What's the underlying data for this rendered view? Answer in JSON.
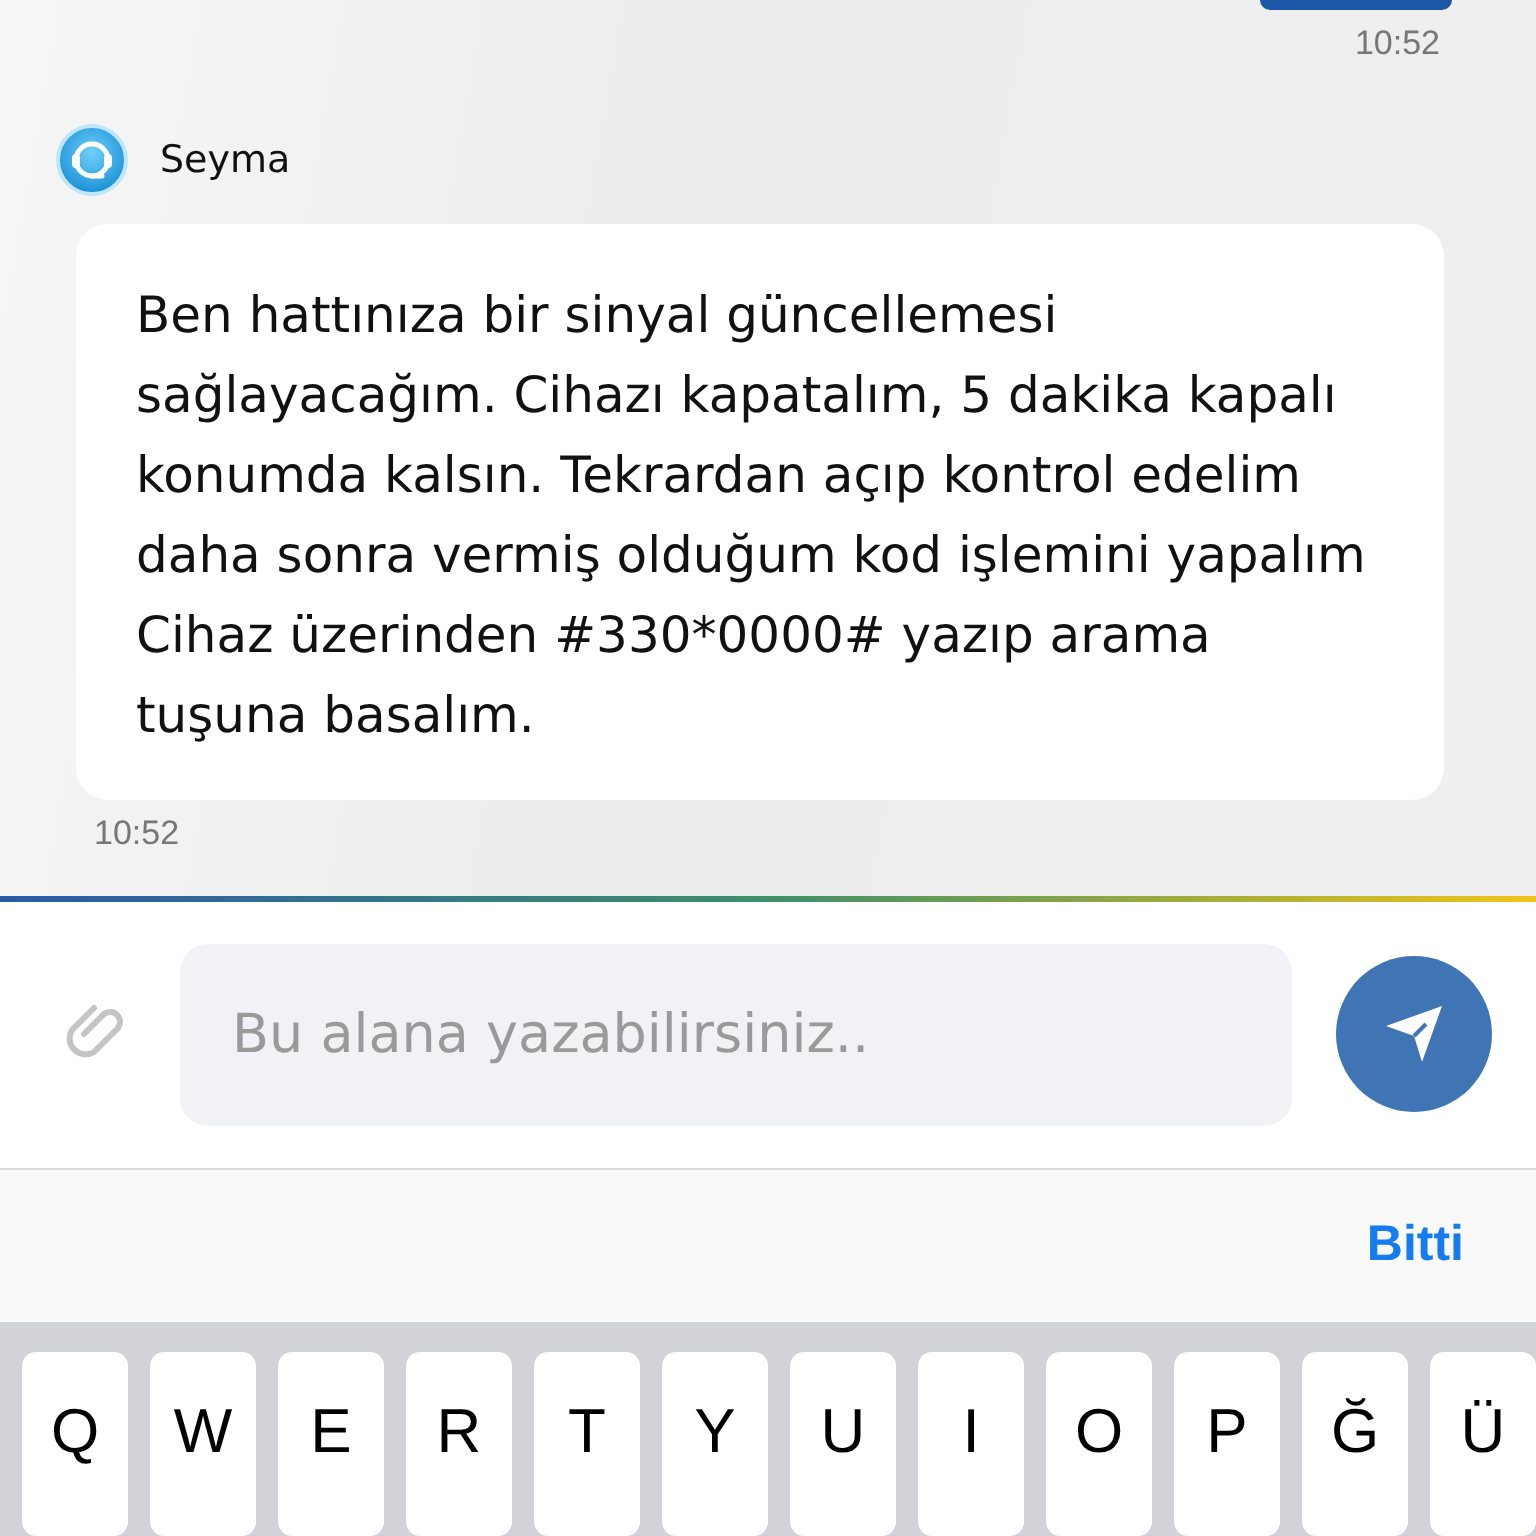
{
  "sent_message": {
    "time": "10:52"
  },
  "agent": {
    "name": "Seyma"
  },
  "received_message": {
    "text": "Ben hattınıza bir sinyal güncellemesi sağlayacağım. Cihazı kapatalım, 5 dakika kapalı konumda kalsın. Tekrardan açıp kontrol edelim daha sonra vermiş olduğum kod işlemini yapalım\nCihaz üzerinden #330*0000# yazıp arama tuşuna basalım.",
    "time": "10:52"
  },
  "composer": {
    "placeholder": "Bu alana yazabilirsiniz.."
  },
  "keyboard_toolbar": {
    "done": "Bitti"
  },
  "keyboard_keys": [
    "Q",
    "W",
    "E",
    "R",
    "T",
    "Y",
    "U",
    "I",
    "O",
    "P",
    "Ğ",
    "Ü"
  ]
}
